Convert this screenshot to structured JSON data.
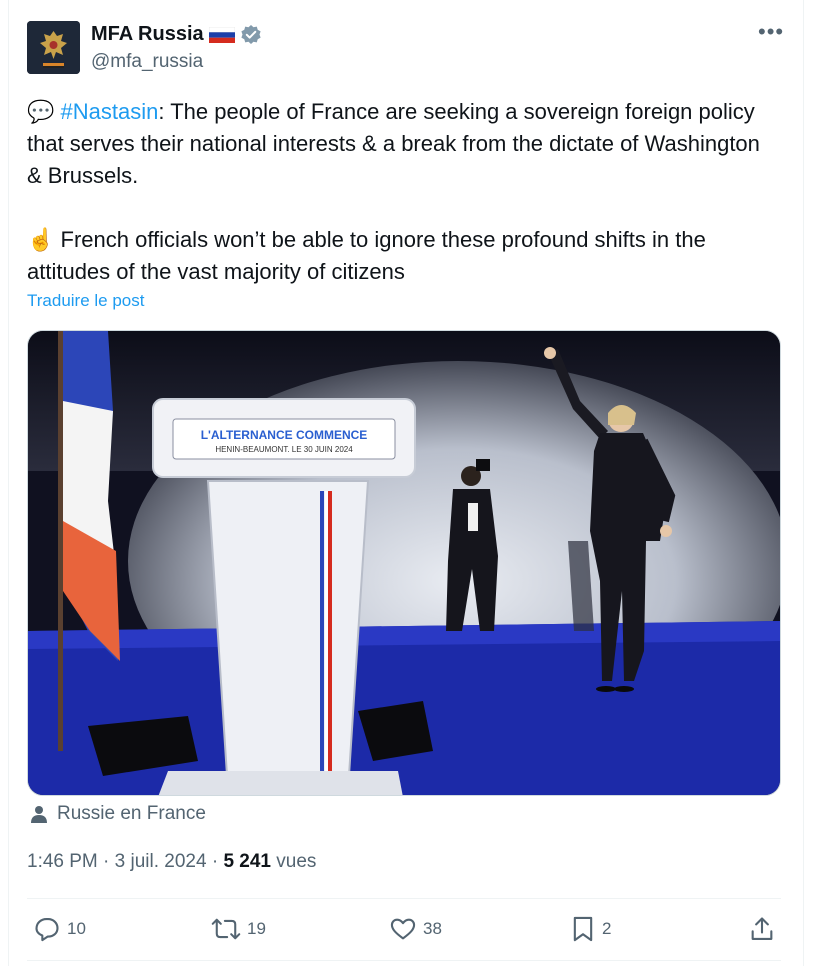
{
  "author": {
    "name": "MFA Russia",
    "flag": "🇷🇺",
    "handle": "@mfa_russia",
    "verified_color": "#829aab"
  },
  "more_label": "•••",
  "post": {
    "speech_emoji": "💬",
    "hashtag": "#Nastasin",
    "line1_rest": ": The people of France are seeking a sovereign foreign policy that serves their national interests & a break from the dictate of Washington & Brussels.",
    "point_emoji": "☝️",
    "line2": " French officials won’t be able to ignore these profound shifts in the attitudes of the vast majority of citizens"
  },
  "translate_label": "Traduire le post",
  "image": {
    "podium_title": "L'ALTERNANCE COMMENCE",
    "podium_subtitle": "HENIN-BEAUMONT. LE 30 JUIN 2024"
  },
  "location": "Russie en France",
  "meta": {
    "time_date": "1:46 PM · 3 juil. 2024 · ",
    "views_count": "5 241",
    "views_label": " vues"
  },
  "actions": {
    "replies": "10",
    "reposts": "19",
    "likes": "38",
    "bookmarks": "2"
  },
  "colors": {
    "accent": "#1d9bf0",
    "secondary_text": "#536471"
  }
}
